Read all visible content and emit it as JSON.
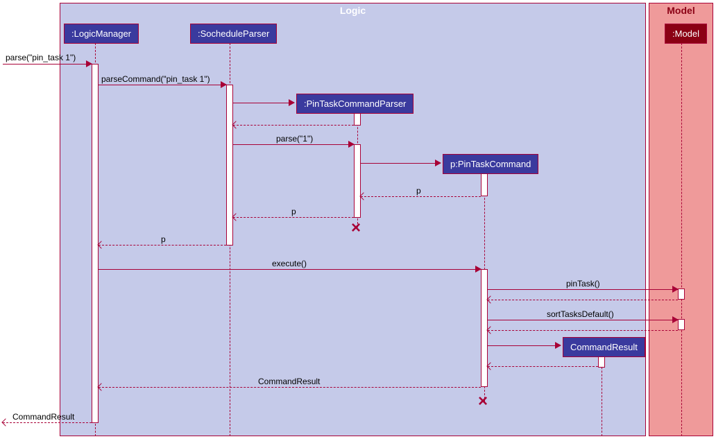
{
  "frames": {
    "logic": {
      "label": "Logic"
    },
    "model": {
      "label": "Model"
    }
  },
  "participants": {
    "logicManager": ":LogicManager",
    "socheduleParser": ":SocheduleParser",
    "pinTaskCommandParser": ":PinTaskCommandParser",
    "pinTaskCommand": "p:PinTaskCommand",
    "commandResult": "CommandResult",
    "model": ":Model"
  },
  "messages": {
    "m1": "parse(\"pin_task 1\")",
    "m2": "parseCommand(\"pin_task 1\")",
    "m3": "parse(\"1\")",
    "m4": "p",
    "m5": "p",
    "m6": "p",
    "m7": "execute()",
    "m8": "pinTask()",
    "m9": "sortTasksDefault()",
    "m10": "CommandResult",
    "m11": "CommandResult"
  },
  "chart_data": {
    "type": "sequence_diagram",
    "frames": [
      {
        "name": "Logic",
        "contains": [
          "LogicManager",
          "SocheduleParser",
          "PinTaskCommandParser",
          "PinTaskCommand",
          "CommandResult"
        ]
      },
      {
        "name": "Model",
        "contains": [
          "Model"
        ]
      }
    ],
    "participants": [
      {
        "id": "caller",
        "label": "(external)"
      },
      {
        "id": "LogicManager",
        "label": ":LogicManager"
      },
      {
        "id": "SocheduleParser",
        "label": ":SocheduleParser"
      },
      {
        "id": "PinTaskCommandParser",
        "label": ":PinTaskCommandParser",
        "created_by": 3,
        "destroyed_after": 8
      },
      {
        "id": "PinTaskCommand",
        "label": "p:PinTaskCommand",
        "created_by": 5,
        "destroyed_after": 15
      },
      {
        "id": "CommandResult",
        "label": "CommandResult",
        "created_by": 13
      },
      {
        "id": "Model",
        "label": ":Model"
      }
    ],
    "messages": [
      {
        "n": 1,
        "from": "caller",
        "to": "LogicManager",
        "label": "parse(\"pin_task 1\")",
        "kind": "sync"
      },
      {
        "n": 2,
        "from": "LogicManager",
        "to": "SocheduleParser",
        "label": "parseCommand(\"pin_task 1\")",
        "kind": "sync"
      },
      {
        "n": 3,
        "from": "SocheduleParser",
        "to": "PinTaskCommandParser",
        "label": "",
        "kind": "create"
      },
      {
        "n": 4,
        "from": "PinTaskCommandParser",
        "to": "SocheduleParser",
        "label": "",
        "kind": "return"
      },
      {
        "n": 5,
        "from": "SocheduleParser",
        "to": "PinTaskCommandParser",
        "label": "parse(\"1\")",
        "kind": "sync"
      },
      {
        "n": 6,
        "from": "PinTaskCommandParser",
        "to": "PinTaskCommand",
        "label": "",
        "kind": "create"
      },
      {
        "n": 7,
        "from": "PinTaskCommand",
        "to": "PinTaskCommandParser",
        "label": "p",
        "kind": "return"
      },
      {
        "n": 8,
        "from": "PinTaskCommandParser",
        "to": "SocheduleParser",
        "label": "p",
        "kind": "return"
      },
      {
        "n": 9,
        "from": "SocheduleParser",
        "to": "LogicManager",
        "label": "p",
        "kind": "return"
      },
      {
        "n": 10,
        "from": "LogicManager",
        "to": "PinTaskCommand",
        "label": "execute()",
        "kind": "sync"
      },
      {
        "n": 11,
        "from": "PinTaskCommand",
        "to": "Model",
        "label": "pinTask()",
        "kind": "sync"
      },
      {
        "n": 12,
        "from": "Model",
        "to": "PinTaskCommand",
        "label": "",
        "kind": "return"
      },
      {
        "n": 13,
        "from": "PinTaskCommand",
        "to": "Model",
        "label": "sortTasksDefault()",
        "kind": "sync"
      },
      {
        "n": 14,
        "from": "Model",
        "to": "PinTaskCommand",
        "label": "",
        "kind": "return"
      },
      {
        "n": 15,
        "from": "PinTaskCommand",
        "to": "CommandResult",
        "label": "",
        "kind": "create"
      },
      {
        "n": 16,
        "from": "CommandResult",
        "to": "PinTaskCommand",
        "label": "",
        "kind": "return"
      },
      {
        "n": 17,
        "from": "PinTaskCommand",
        "to": "LogicManager",
        "label": "CommandResult",
        "kind": "return"
      },
      {
        "n": 18,
        "from": "LogicManager",
        "to": "caller",
        "label": "CommandResult",
        "kind": "return"
      }
    ]
  }
}
